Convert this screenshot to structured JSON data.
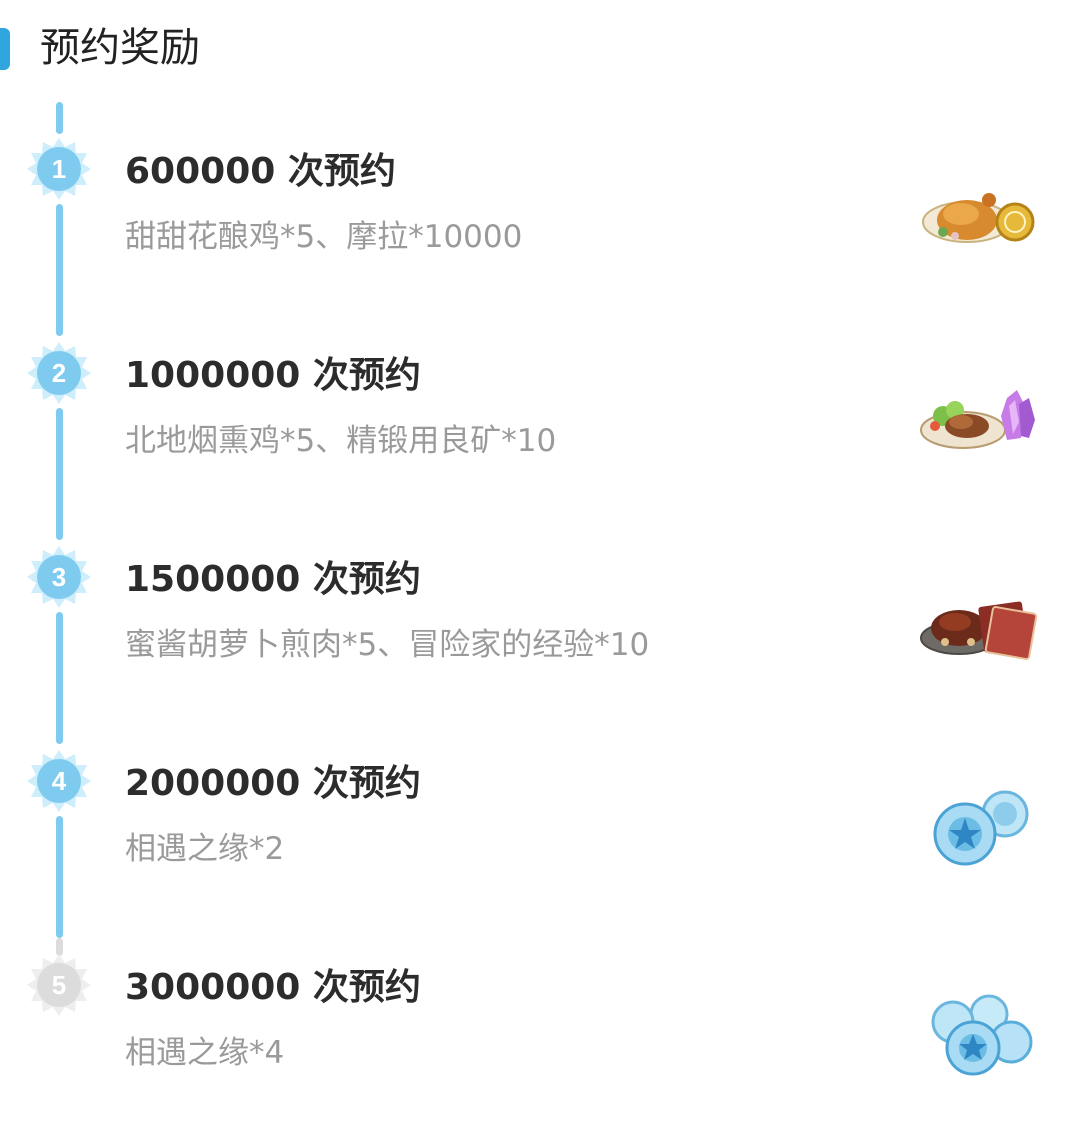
{
  "header": {
    "title": "预约奖励"
  },
  "colors": {
    "accent": "#2fa6de",
    "active": "#7ecbef",
    "inactive": "#dcdcdc"
  },
  "milestones": [
    {
      "number": "1",
      "title": "600000 次预约",
      "reward": "甜甜花酿鸡*5、摩拉*10000",
      "reward_icon": "roast-chicken-and-coin-icon",
      "active": true
    },
    {
      "number": "2",
      "title": "1000000 次预约",
      "reward": "北地烟熏鸡*5、精锻用良矿*10",
      "reward_icon": "smoked-chicken-and-crystal-ore-icon",
      "active": true
    },
    {
      "number": "3",
      "title": "1500000 次预约",
      "reward": "蜜酱胡萝卜煎肉*5、冒险家的经验*10",
      "reward_icon": "glazed-meat-and-book-icon",
      "active": true
    },
    {
      "number": "4",
      "title": "2000000 次预约",
      "reward": "相遇之缘*2",
      "reward_icon": "two-fate-orbs-icon",
      "active": true
    },
    {
      "number": "5",
      "title": "3000000 次预约",
      "reward": "相遇之缘*4",
      "reward_icon": "four-fate-orbs-icon",
      "active": false
    }
  ]
}
